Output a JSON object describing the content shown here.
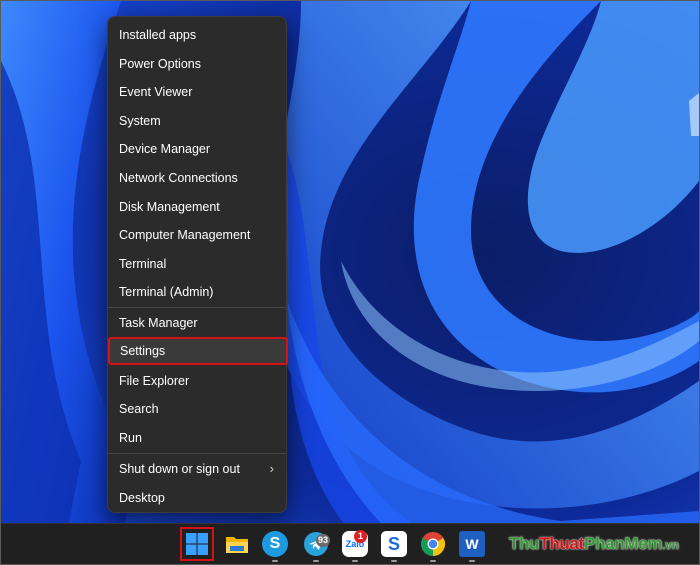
{
  "menu": {
    "items": [
      {
        "label": "Installed apps"
      },
      {
        "label": "Power Options"
      },
      {
        "label": "Event Viewer"
      },
      {
        "label": "System"
      },
      {
        "label": "Device Manager"
      },
      {
        "label": "Network Connections"
      },
      {
        "label": "Disk Management"
      },
      {
        "label": "Computer Management"
      },
      {
        "label": "Terminal"
      },
      {
        "label": "Terminal (Admin)"
      },
      {
        "label": "Task Manager"
      },
      {
        "label": "Settings"
      },
      {
        "label": "File Explorer"
      },
      {
        "label": "Search"
      },
      {
        "label": "Run"
      },
      {
        "label": "Shut down or sign out"
      },
      {
        "label": "Desktop"
      }
    ],
    "submenu_chevron": "›"
  },
  "taskbar": {
    "icons": [
      {
        "name": "start-icon"
      },
      {
        "name": "file-explorer-icon"
      },
      {
        "name": "skype-icon",
        "letter": "S"
      },
      {
        "name": "telegram-icon",
        "badge": "93"
      },
      {
        "name": "zalo-icon",
        "letter": "Zalo",
        "badge": "1"
      },
      {
        "name": "snagit-icon",
        "letter": "S"
      },
      {
        "name": "chrome-icon"
      },
      {
        "name": "word-icon",
        "letter": "W"
      }
    ]
  },
  "watermark": {
    "part1": "Thu",
    "part2": "Thuat",
    "part3": "PhanMem",
    "part4": ".vn"
  },
  "colors": {
    "menu_bg": "#2b2b2b",
    "highlight_border": "#d41414",
    "taskbar_bg": "#202020",
    "wallpaper": "#1f4fe0"
  }
}
